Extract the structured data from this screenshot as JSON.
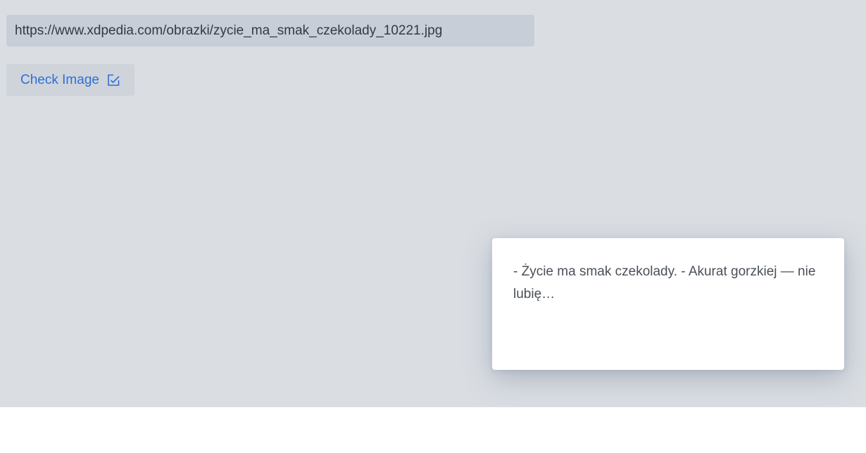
{
  "url_field": {
    "value": "https://www.xdpedia.com/obrazki/zycie_ma_smak_czekolady_10221.jpg"
  },
  "check_button": {
    "label": "Check Image",
    "icon": "edit-check-icon"
  },
  "quote_card": {
    "text": "- Życie ma smak czekolady. - Akurat gorzkiej — nie lubię…"
  },
  "colors": {
    "background": "#dadee3",
    "input_bg": "#c8ced8",
    "button_bg": "#cfd4db",
    "accent": "#2f6fd8",
    "card_bg": "#ffffff",
    "text": "#4a5058"
  }
}
